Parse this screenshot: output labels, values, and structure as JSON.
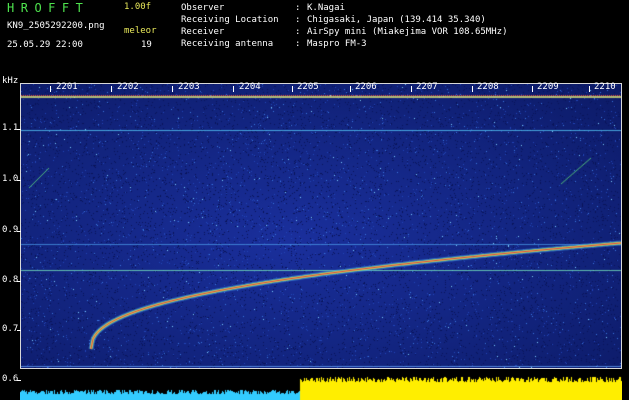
{
  "header": {
    "app_title": "HROFFT",
    "app_version": "1.00f",
    "file_name": "KN9_2505292200.png",
    "run_name": "meleor",
    "timestamp": "25.05.29 22:00",
    "count": "19"
  },
  "station_info": [
    {
      "label": "Observer",
      "value": "K.Nagai"
    },
    {
      "label": "Receiving Location",
      "value": "Chigasaki, Japan (139.414 35.340)"
    },
    {
      "label": "Receiver",
      "value": "AirSpy mini (Miakejima VOR 108.65MHz)"
    },
    {
      "label": "Receiving antenna",
      "value": "Maspro FM-3"
    }
  ],
  "axis": {
    "y_unit": "kHz",
    "y_ticks": [
      "1.1",
      "1.0",
      "0.9",
      "0.8",
      "0.7",
      "0.6"
    ],
    "x_ticks": [
      "2201",
      "2202",
      "2203",
      "2204",
      "2205",
      "2206",
      "2207",
      "2208",
      "2209",
      "2210"
    ]
  },
  "colors": {
    "background": "#000000",
    "plot_bg": "#12247f",
    "title_green": "#4ee34e",
    "label_yellow": "#e8e85a",
    "level_cyan": "#33ccff",
    "level_yellow": "#ffee00"
  }
}
